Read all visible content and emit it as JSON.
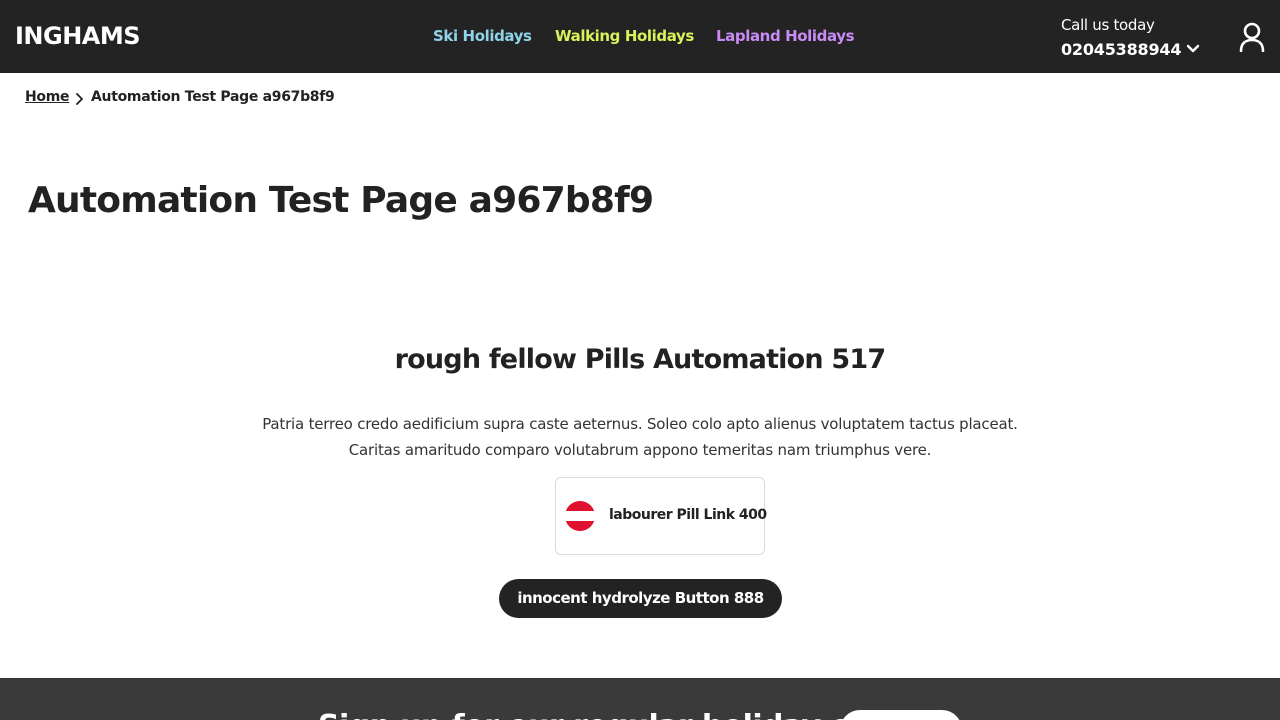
{
  "header": {
    "logo": "INGHAMS",
    "nav": [
      {
        "label": "Ski Holidays",
        "color": "#8fd3e8"
      },
      {
        "label": "Walking Holidays",
        "color": "#d9f25a"
      },
      {
        "label": "Lapland Holidays",
        "color": "#c98bf5"
      }
    ],
    "call_label": "Call us today",
    "call_number": "02045388944",
    "icons": {
      "dropdown": "chevron-down-icon",
      "account": "user-icon"
    }
  },
  "breadcrumb": {
    "home": "Home",
    "current": "Automation Test Page a967b8f9"
  },
  "page_title": "Automation Test Page a967b8f9",
  "section": {
    "heading": "rough fellow Pills Automation 517",
    "body_line1": "Patria terreo credo aedificium supra caste aeternus. Soleo colo apto alienus voluptatem tactus placeat.",
    "body_line2": "Caritas amaritudo comparo volutabrum appono temeritas nam triumphus vere.",
    "pill": {
      "label": "labourer Pill Link 400",
      "icon": "austria-flag-icon"
    },
    "button": "innocent hydrolyze Button 888"
  },
  "newsletter": {
    "heading": "Sign up for our regular holiday offers"
  },
  "colors": {
    "header_bg": "#232323",
    "footer_bg": "#3a3a3a",
    "flag_red": "#e0102f"
  }
}
